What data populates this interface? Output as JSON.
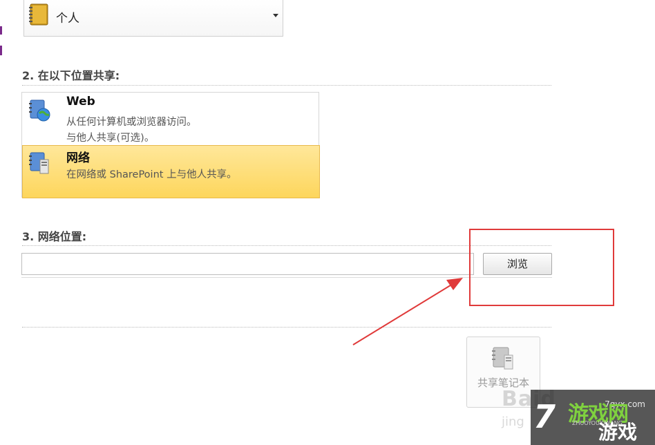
{
  "notebook": {
    "name": "个人"
  },
  "section2": {
    "heading": "2. 在以下位置共享:"
  },
  "locations": [
    {
      "title": "Web",
      "desc1": "从任何计算机或浏览器访问。",
      "desc2": "与他人共享(可选)。"
    },
    {
      "title": "网络",
      "desc1": "在网络或 SharePoint 上与他人共享。"
    }
  ],
  "section3": {
    "heading": "3. 网络位置:"
  },
  "path_input": {
    "value": "",
    "placeholder": ""
  },
  "browse": {
    "label": "浏览"
  },
  "share": {
    "label": "共享笔记本"
  },
  "watermark": {
    "baidu": "Baid",
    "baidu_sub": "jing",
    "seven": "7",
    "url": "7qyx.com",
    "logo_text": "游戏网",
    "logo_small": "ZHUOYOUXIWANG",
    "logo_game": "游戏"
  },
  "colors": {
    "selected_bg": "#fdd65c",
    "highlight_red": "#e03a3a",
    "accent_purple": "#7a2a8a"
  }
}
